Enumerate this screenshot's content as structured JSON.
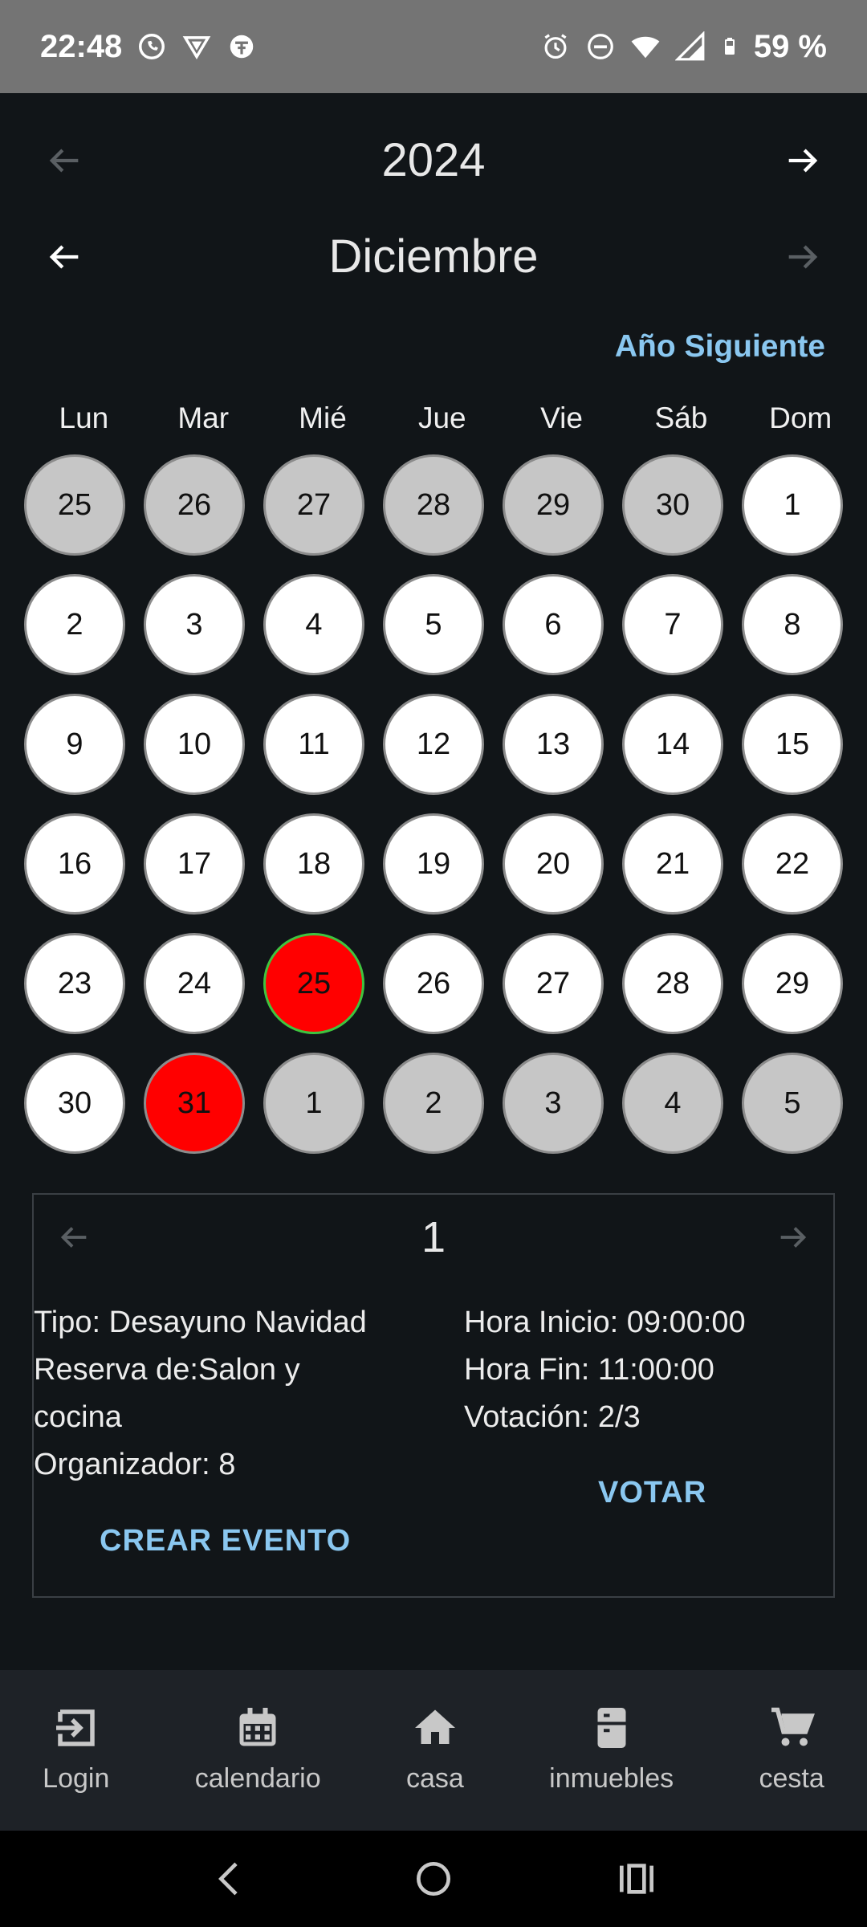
{
  "status_bar": {
    "time": "22:48",
    "battery": "59 %",
    "left_icons": [
      "whatsapp-icon",
      "vpn-shield-icon",
      "app-icon"
    ],
    "right_icons": [
      "alarm-icon",
      "do-not-disturb-icon",
      "wifi-icon",
      "signal-icon",
      "battery-icon"
    ]
  },
  "year_nav": {
    "year": "2024"
  },
  "month_nav": {
    "month": "Diciembre"
  },
  "next_year_label": "Año Siguiente",
  "weekdays": [
    "Lun",
    "Mar",
    "Mié",
    "Jue",
    "Vie",
    "Sáb",
    "Dom"
  ],
  "days": [
    {
      "n": "25",
      "state": "other"
    },
    {
      "n": "26",
      "state": "other"
    },
    {
      "n": "27",
      "state": "other"
    },
    {
      "n": "28",
      "state": "other"
    },
    {
      "n": "29",
      "state": "other"
    },
    {
      "n": "30",
      "state": "other"
    },
    {
      "n": "1",
      "state": "current"
    },
    {
      "n": "2",
      "state": "current"
    },
    {
      "n": "3",
      "state": "current"
    },
    {
      "n": "4",
      "state": "current"
    },
    {
      "n": "5",
      "state": "current"
    },
    {
      "n": "6",
      "state": "current"
    },
    {
      "n": "7",
      "state": "current"
    },
    {
      "n": "8",
      "state": "current"
    },
    {
      "n": "9",
      "state": "current"
    },
    {
      "n": "10",
      "state": "current"
    },
    {
      "n": "11",
      "state": "current"
    },
    {
      "n": "12",
      "state": "current"
    },
    {
      "n": "13",
      "state": "current"
    },
    {
      "n": "14",
      "state": "current"
    },
    {
      "n": "15",
      "state": "current"
    },
    {
      "n": "16",
      "state": "current"
    },
    {
      "n": "17",
      "state": "current"
    },
    {
      "n": "18",
      "state": "current"
    },
    {
      "n": "19",
      "state": "current"
    },
    {
      "n": "20",
      "state": "current"
    },
    {
      "n": "21",
      "state": "current"
    },
    {
      "n": "22",
      "state": "current"
    },
    {
      "n": "23",
      "state": "current"
    },
    {
      "n": "24",
      "state": "current"
    },
    {
      "n": "25",
      "state": "event-today"
    },
    {
      "n": "26",
      "state": "current"
    },
    {
      "n": "27",
      "state": "current"
    },
    {
      "n": "28",
      "state": "current"
    },
    {
      "n": "29",
      "state": "current"
    },
    {
      "n": "30",
      "state": "current"
    },
    {
      "n": "31",
      "state": "event"
    },
    {
      "n": "1",
      "state": "other"
    },
    {
      "n": "2",
      "state": "other"
    },
    {
      "n": "3",
      "state": "other"
    },
    {
      "n": "4",
      "state": "other"
    },
    {
      "n": "5",
      "state": "other"
    }
  ],
  "event": {
    "index": "1",
    "tipo": "Tipo: Desayuno Navidad",
    "reserva_line1": "Reserva de:Salon y",
    "reserva_line2": "cocina",
    "organizador": "Organizador: 8",
    "hora_inicio": "Hora Inicio: 09:00:00",
    "hora_fin": "Hora Fin: 11:00:00",
    "votacion": "Votación: 2/3",
    "vote_label": "VOTAR",
    "create_label": "CREAR EVENTO"
  },
  "bottom_nav": [
    {
      "label": "Login",
      "icon": "login-icon"
    },
    {
      "label": "calendario",
      "icon": "calendar-icon"
    },
    {
      "label": "casa",
      "icon": "home-icon"
    },
    {
      "label": "inmuebles",
      "icon": "building-icon"
    },
    {
      "label": "cesta",
      "icon": "cart-icon"
    }
  ],
  "colors": {
    "background": "#111518",
    "accent": "#8ac7f0",
    "event_day": "#ff0000",
    "other_month_day": "#c6c6c6",
    "today_border": "#3fc43f"
  }
}
